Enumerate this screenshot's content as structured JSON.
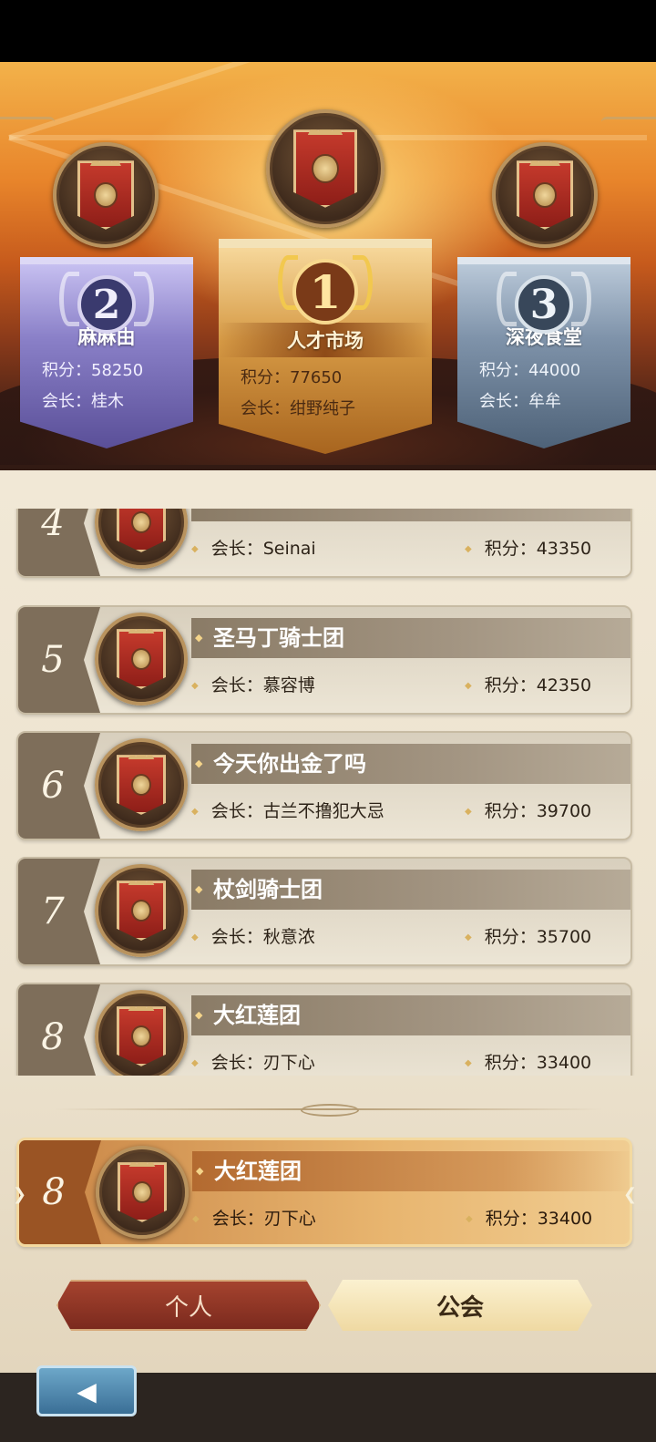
{
  "podium": {
    "first": {
      "rank": "1",
      "name": "人才市场",
      "score_line": "积分：77650",
      "leader_line": "会长：绀野纯子"
    },
    "second": {
      "rank": "2",
      "name": "麻麻由",
      "score_line": "积分：58250",
      "leader_line": "会长：桂木"
    },
    "third": {
      "rank": "3",
      "name": "深夜食堂",
      "score_line": "积分：44000",
      "leader_line": "会长：牟牟"
    }
  },
  "list": [
    {
      "rank": "4",
      "name": "",
      "leader": "会长：Seinai",
      "score": "积分：43350"
    },
    {
      "rank": "5",
      "name": "圣马丁骑士团",
      "leader": "会长：慕容博",
      "score": "积分：42350"
    },
    {
      "rank": "6",
      "name": "今天你出金了吗",
      "leader": "会长：古兰不撸犯大忌",
      "score": "积分：39700"
    },
    {
      "rank": "7",
      "name": "杖剑骑士团",
      "leader": "会长：秋意浓",
      "score": "积分：35700"
    },
    {
      "rank": "8",
      "name": "大红莲团",
      "leader": "会长：刃下心",
      "score": "积分：33400"
    }
  ],
  "my_guild": {
    "rank": "8",
    "name": "大红莲团",
    "leader": "会长：刃下心",
    "score": "积分：33400"
  },
  "tabs": {
    "personal": "个人",
    "guild": "公会"
  },
  "back_icon": "◀"
}
